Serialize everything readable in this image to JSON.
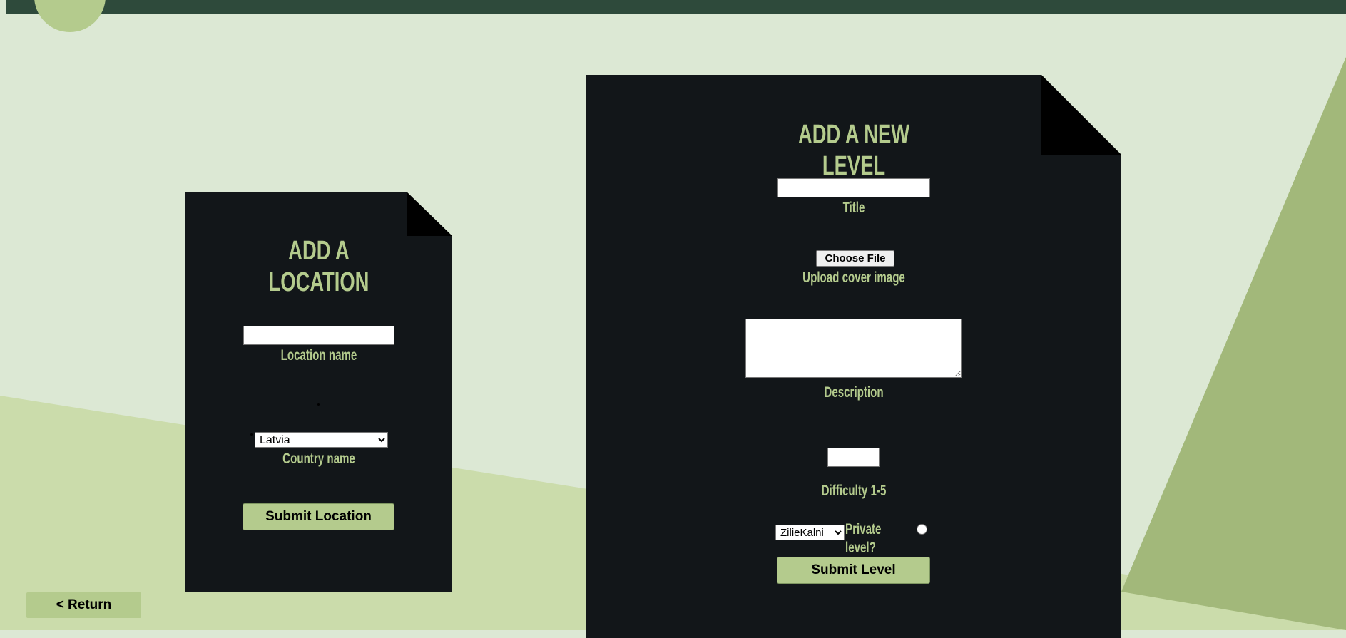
{
  "location_form": {
    "title": "ADD A LOCATION",
    "location_name_label": "Location name",
    "location_name_value": "",
    "country_label": "Country name",
    "country_selected": "Latvia",
    "submit_label": "Submit Location"
  },
  "level_form": {
    "title": "ADD A NEW LEVEL",
    "title_field_label": "Title",
    "title_field_value": "",
    "file_button_label": "Choose File",
    "upload_label": "Upload cover image",
    "description_label": "Description",
    "difficulty_label": "Difficulty 1-5",
    "location_selected": "ZilieKalni",
    "private_label": "Private level?",
    "submit_label": "Submit Level"
  },
  "nav": {
    "return_label": "< Return"
  }
}
